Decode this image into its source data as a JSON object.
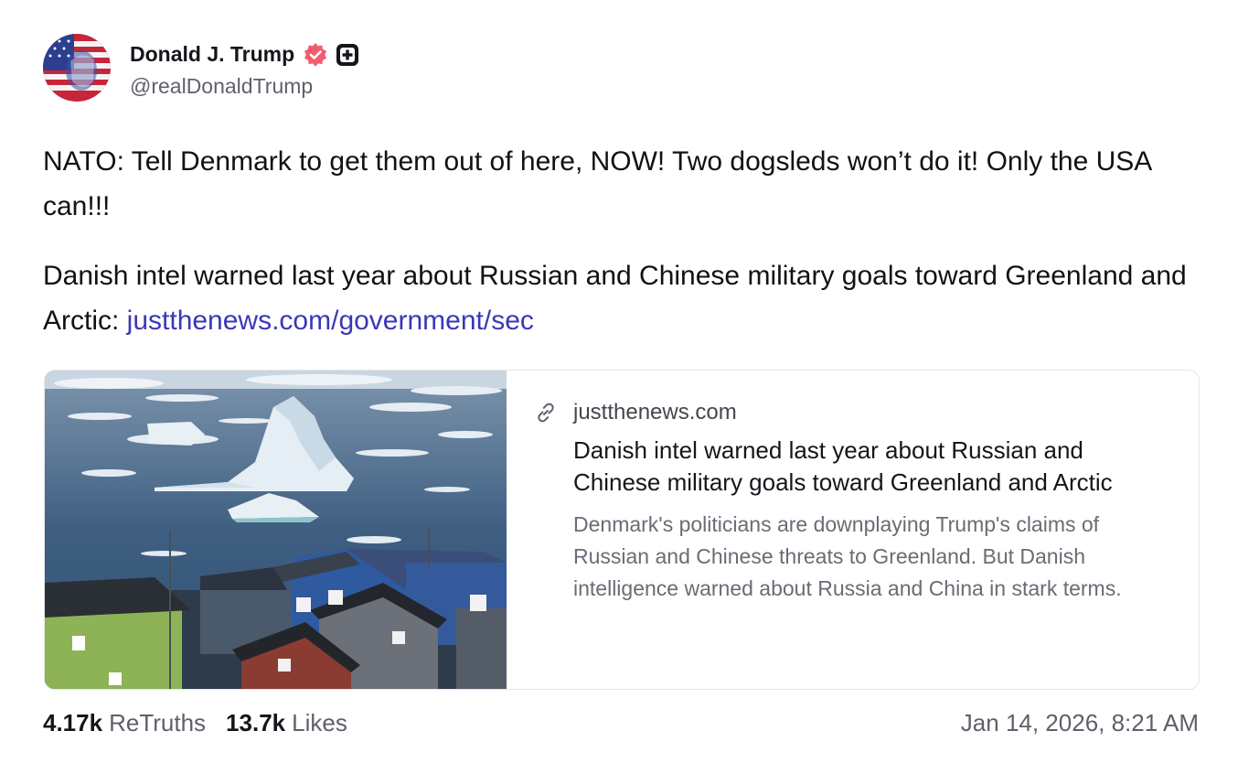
{
  "author": {
    "display_name": "Donald J. Trump",
    "handle": "@realDonaldTrump",
    "avatar_icon": "avatar-flag-portrait",
    "verified_icon": "verified-badge-icon",
    "badge_icon": "plus-badge-icon"
  },
  "post": {
    "paragraph1": "NATO: Tell Denmark to get them out of here, NOW! Two dogsleds won’t do it! Only the USA can!!!",
    "paragraph2_text": "Danish intel warned last year about Russian and Chinese military goals toward Greenland and Arctic: ",
    "paragraph2_link": "justthenews.com/government/sec"
  },
  "link_card": {
    "domain": "justthenews.com",
    "title": "Danish intel warned last year about Russian and Chinese military goals toward Greenland and Arctic",
    "description": "Denmark's politicians are downplaying Trump's claims of Russian and Chinese threats to Greenland. But Danish intelligence warned about Russia and China in stark terms."
  },
  "stats": {
    "retruths_count": "4.17k",
    "retruths_label": "ReTruths",
    "likes_count": "13.7k",
    "likes_label": "Likes"
  },
  "timestamp": "Jan 14, 2026, 8:21 AM",
  "colors": {
    "link": "#3b37b8",
    "verified": "#f35b6f"
  }
}
